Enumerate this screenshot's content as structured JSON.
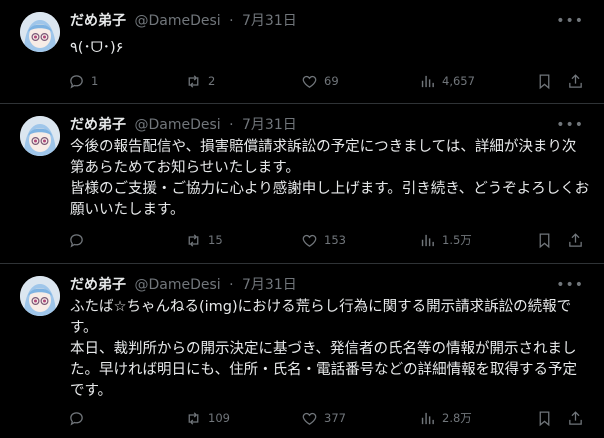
{
  "tweets": [
    {
      "name": "だめ弟子",
      "handle": "@DameDesi",
      "sep": "·",
      "date": "7月31日",
      "text": [
        "٩(･ᗜ･)۶"
      ],
      "replies": "1",
      "retweets": "2",
      "likes": "69",
      "views": "4,657"
    },
    {
      "name": "だめ弟子",
      "handle": "@DameDesi",
      "sep": "·",
      "date": "7月31日",
      "text": [
        "今後の報告配信や、損害賠償請求訴訟の予定につきましては、詳細が決まり次第あらためてお知らせいたします。",
        "皆様のご支援・ご協力に心より感謝申し上げます。引き続き、どうぞよろしくお願いいたします。"
      ],
      "replies": "",
      "retweets": "15",
      "likes": "153",
      "views": "1.5万"
    },
    {
      "name": "だめ弟子",
      "handle": "@DameDesi",
      "sep": "·",
      "date": "7月31日",
      "text": [
        "ふたば☆ちゃんねる(img)における荒らし行為に関する開示請求訴訟の続報です。",
        "本日、裁判所からの開示決定に基づき、発信者の氏名等の情報が開示されました。早ければ明日にも、住所・氏名・電話番号などの詳細情報を取得する予定です。"
      ],
      "replies": "",
      "retweets": "109",
      "likes": "377",
      "views": "2.8万"
    }
  ],
  "icons": {
    "reply": "reply-icon",
    "retweet": "retweet-icon",
    "like": "heart-icon",
    "views": "views-chart-icon",
    "bookmark": "bookmark-icon",
    "share": "share-icon",
    "more": "more-icon"
  },
  "colors": {
    "background": "#000000",
    "text": "#e7e9ea",
    "muted": "#71767b",
    "divider": "#2f3336"
  }
}
